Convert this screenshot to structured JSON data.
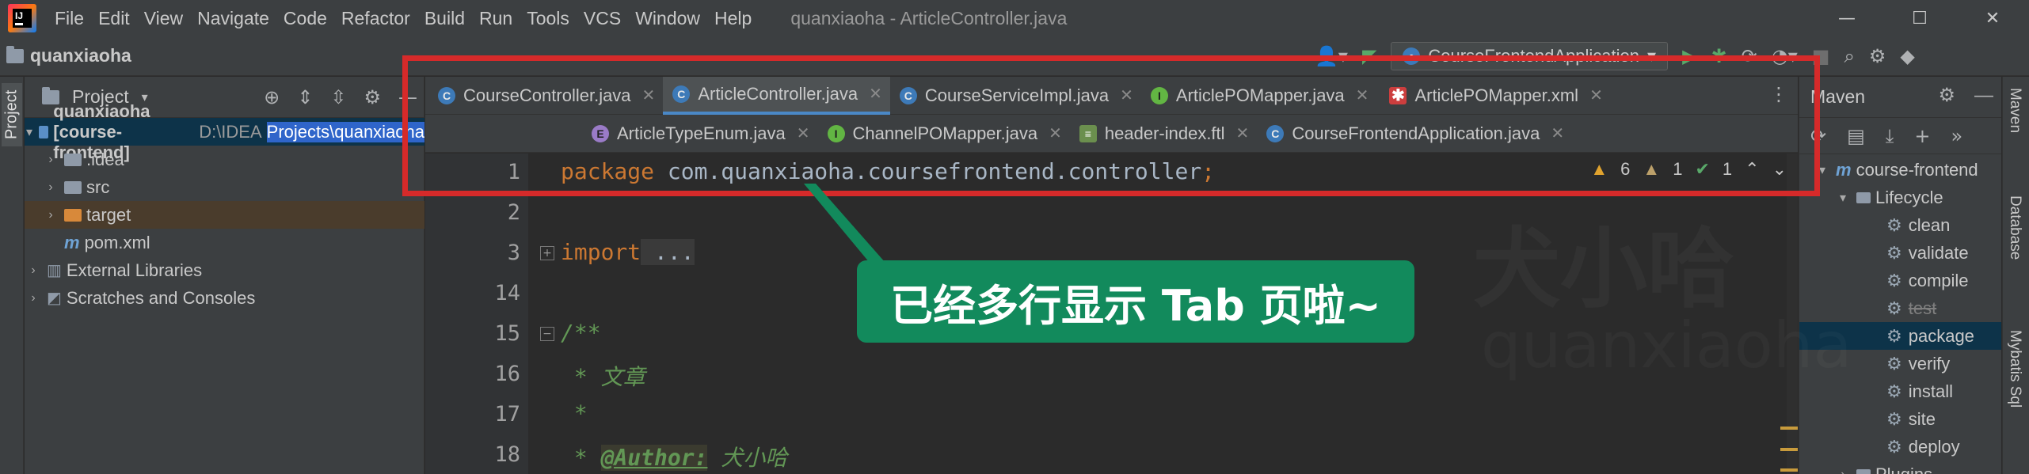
{
  "menu": [
    "File",
    "Edit",
    "View",
    "Navigate",
    "Code",
    "Refactor",
    "Build",
    "Run",
    "Tools",
    "VCS",
    "Window",
    "Help"
  ],
  "window_title": "quanxiaoha - ArticleController.java",
  "window_controls": {
    "minimize": "—",
    "maximize": "☐",
    "close": "✕"
  },
  "nav": {
    "project_name": "quanxiaoha",
    "run_config": "CourseFrontendApplication"
  },
  "left_strip_label": "Project",
  "project_panel": {
    "title": "Project",
    "tree": [
      {
        "name": "quanxiaoha [course-frontend]",
        "path": "D:\\IDEA",
        "path_sel": "Projects\\quanxiaoha"
      },
      {
        "name": ".idea"
      },
      {
        "name": "src"
      },
      {
        "name": "target"
      },
      {
        "name": "pom.xml"
      },
      {
        "name": "External Libraries"
      },
      {
        "name": "Scratches and Consoles"
      }
    ]
  },
  "tabs_row1": [
    {
      "label": "CourseController.java",
      "icon": "C"
    },
    {
      "label": "ArticleController.java",
      "icon": "C"
    },
    {
      "label": "CourseServiceImpl.java",
      "icon": "C"
    },
    {
      "label": "ArticlePOMapper.java",
      "icon": "I"
    },
    {
      "label": "ArticlePOMapper.xml",
      "icon": "X"
    }
  ],
  "tabs_row2": [
    {
      "label": "ArticleTypeEnum.java",
      "icon": "E"
    },
    {
      "label": "ChannelPOMapper.java",
      "icon": "I"
    },
    {
      "label": "header-index.ftl",
      "icon": "F"
    },
    {
      "label": "CourseFrontendApplication.java",
      "icon": "C"
    }
  ],
  "editor": {
    "line_numbers": [
      "1",
      "2",
      "3",
      "14",
      "15",
      "16",
      "17",
      "18"
    ],
    "line1_kw": "package",
    "line1_pkg": " com.quanxiaoha.coursefrontend.controller",
    "line1_semi": ";",
    "line3_kw": "import",
    "line3_rest": " ...",
    "line15": "/**",
    "line16": " * 文章",
    "line17": " *",
    "line18_star": " * ",
    "line18_tag": "@Author:",
    "line18_val": " 犬小哈",
    "inspections": {
      "warnings": "6",
      "weak_warnings": "1",
      "ok": "1"
    }
  },
  "maven": {
    "title": "Maven",
    "project": "course-frontend",
    "lifecycle": "Lifecycle",
    "goals": [
      "clean",
      "validate",
      "compile",
      "test",
      "package",
      "verify",
      "install",
      "site",
      "deploy"
    ],
    "next": "Plugins"
  },
  "right_strip": [
    "Maven",
    "Database",
    "Mybatis Sql"
  ],
  "callout": "已经多行显示 Tab 页啦~",
  "watermark": {
    "cn": "犬小哈",
    "en": "quanxiaoha"
  },
  "colors": {
    "highlight": "#d62a2a",
    "callout_bg": "#128a5c",
    "active_tab_underline": "#4a88c7"
  }
}
